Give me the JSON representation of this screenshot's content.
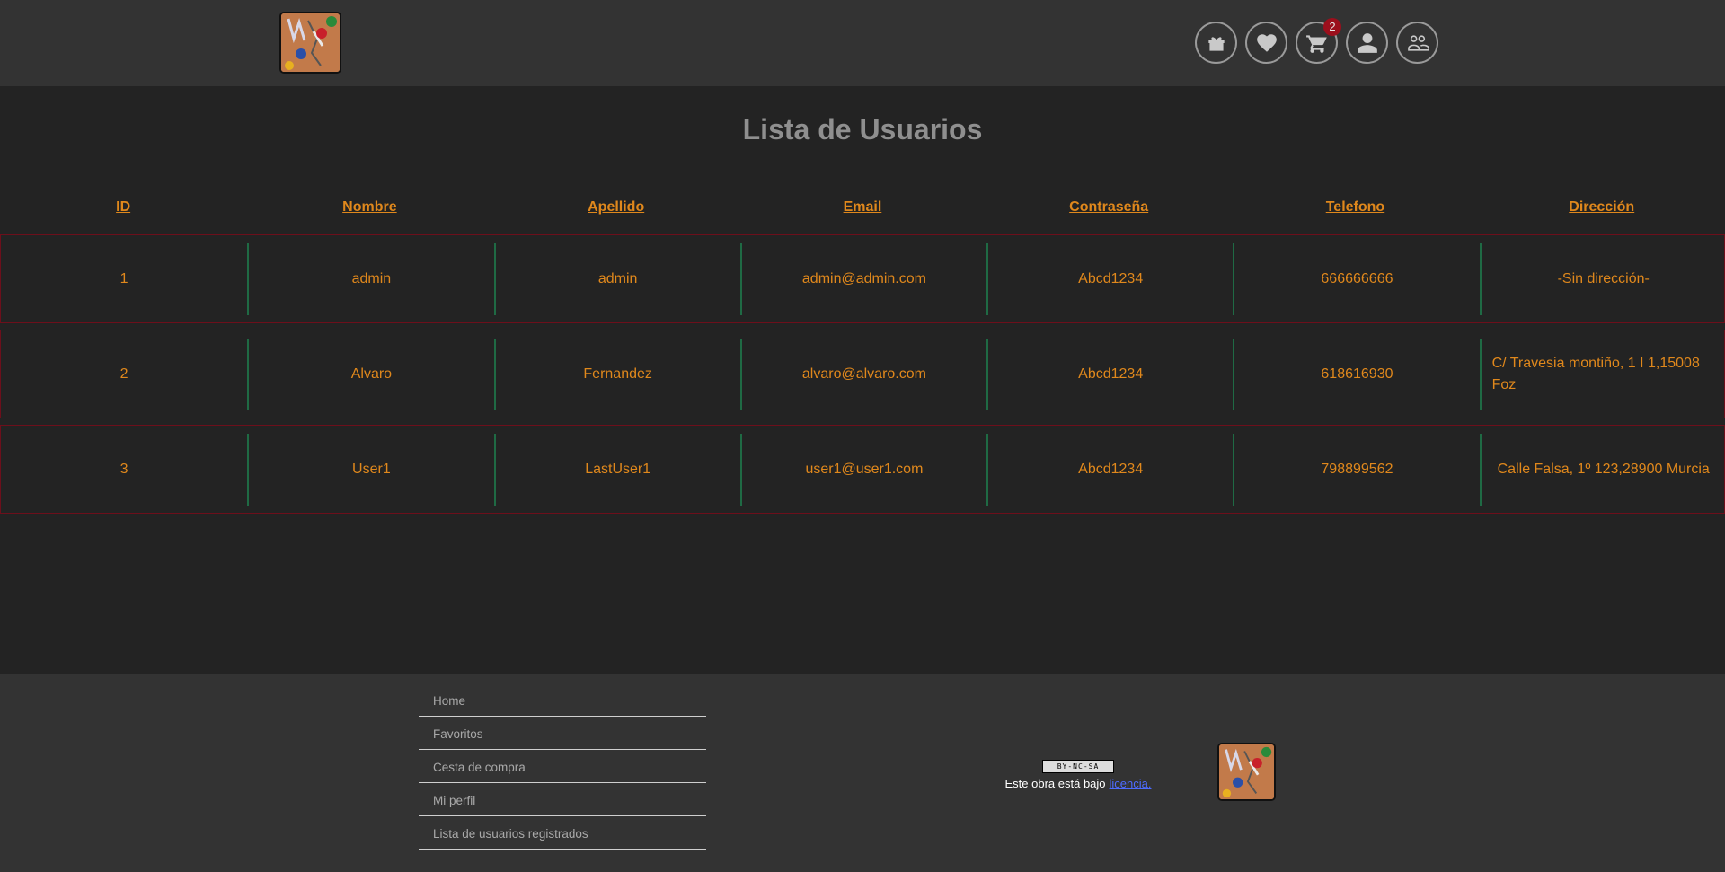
{
  "header": {
    "cart_count": "2",
    "icons": [
      "gift-box-icon",
      "heart-icon",
      "cart-icon",
      "user-icon",
      "users-icon"
    ]
  },
  "page": {
    "title": "Lista de Usuarios"
  },
  "table": {
    "columns": [
      "ID",
      "Nombre",
      "Apellido",
      "Email",
      "Contraseña",
      "Telefono",
      "Dirección"
    ],
    "rows": [
      [
        "1",
        "admin",
        "admin",
        "admin@admin.com",
        "Abcd1234",
        "666666666",
        "-Sin dirección-"
      ],
      [
        "2",
        "Alvaro",
        "Fernandez",
        "alvaro@alvaro.com",
        "Abcd1234",
        "618616930",
        "C/ Travesia montiño, 1 I 1,15008 Foz"
      ],
      [
        "3",
        "User1",
        "LastUser1",
        "user1@user1.com",
        "Abcd1234",
        "798899562",
        "Calle Falsa, 1º 123,28900 Murcia"
      ]
    ]
  },
  "footer": {
    "nav": [
      "Home",
      "Favoritos",
      "Cesta de compra",
      "Mi perfil",
      "Lista de usuarios registrados"
    ],
    "cc_badge": "BY-NC-SA",
    "license_text": "Este obra está bajo",
    "license_link": "licencia."
  },
  "colors": {
    "accent": "#e0881c",
    "header_bg": "#333333",
    "body_bg": "#232323",
    "row_border": "#6d0f1b",
    "cell_divider": "#1f6a44",
    "badge": "#9b0f1c"
  }
}
